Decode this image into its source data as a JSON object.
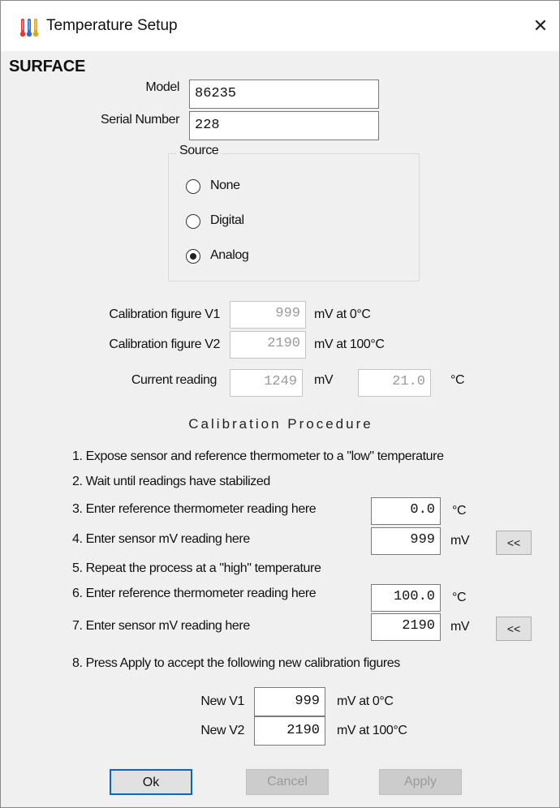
{
  "window": {
    "title": "Temperature Setup",
    "close_glyph": "✕"
  },
  "heading": "SURFACE",
  "model": {
    "label": "Model",
    "value": "86235"
  },
  "serial": {
    "label": "Serial Number",
    "value": "228"
  },
  "source": {
    "title": "Source",
    "options": [
      {
        "label": "None",
        "selected": false
      },
      {
        "label": "Digital",
        "selected": false
      },
      {
        "label": "Analog",
        "selected": true
      }
    ]
  },
  "calibration": {
    "v1": {
      "label": "Calibration figure V1",
      "value": "999",
      "unit": "mV at 0°C"
    },
    "v2": {
      "label": "Calibration figure V2",
      "value": "2190",
      "unit": "mV at 100°C"
    },
    "current": {
      "label": "Current reading",
      "mv_value": "1249",
      "mv_unit": "mV",
      "temp_value": "21.0",
      "temp_unit": "°C"
    }
  },
  "procedure": {
    "title": "Calibration Procedure",
    "step1": "1. Expose sensor and reference thermometer to a \"low\" temperature",
    "step2": "2. Wait until readings have stabilized",
    "step3": {
      "label": "3. Enter reference thermometer reading here",
      "value": "0.0",
      "unit": "°C"
    },
    "step4": {
      "label": "4. Enter sensor mV reading here",
      "value": "999",
      "unit": "mV",
      "button": "<<"
    },
    "step5": "5. Repeat the process at a \"high\" temperature",
    "step6": {
      "label": "6. Enter reference thermometer reading here",
      "value": "100.0",
      "unit": "°C"
    },
    "step7": {
      "label": "7. Enter sensor mV reading here",
      "value": "2190",
      "unit": "mV",
      "button": "<<"
    },
    "step8": "8. Press Apply to accept the following new calibration figures"
  },
  "new_figures": {
    "v1": {
      "label": "New V1",
      "value": "999",
      "unit": "mV at 0°C"
    },
    "v2": {
      "label": "New V2",
      "value": "2190",
      "unit": "mV at 100°C"
    }
  },
  "buttons": {
    "ok": "Ok",
    "cancel": "Cancel",
    "apply": "Apply"
  }
}
